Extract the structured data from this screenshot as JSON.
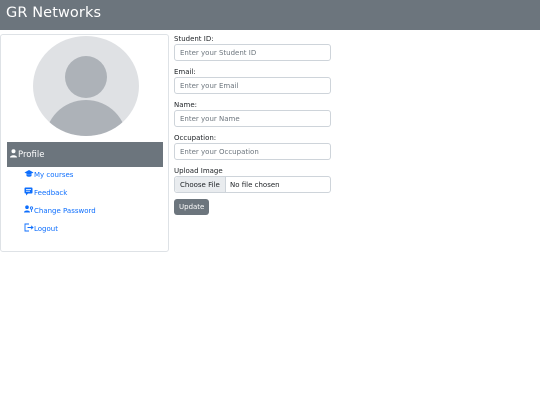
{
  "app": {
    "brand": "GR Networks"
  },
  "sidebar": {
    "profile_label": "Profile",
    "items": [
      {
        "label": "My courses",
        "icon": "graduation-cap-icon"
      },
      {
        "label": "Feedback",
        "icon": "chat-icon"
      },
      {
        "label": "Change Password",
        "icon": "user-key-icon"
      },
      {
        "label": "Logout",
        "icon": "logout-icon"
      }
    ]
  },
  "form": {
    "student_id": {
      "label": "Student ID:",
      "placeholder": "Enter your Student ID",
      "value": ""
    },
    "email": {
      "label": "Email:",
      "placeholder": "Enter your Email",
      "value": ""
    },
    "name": {
      "label": "Name:",
      "placeholder": "Enter your Name",
      "value": ""
    },
    "occupation": {
      "label": "Occupation:",
      "placeholder": "Enter your Occupation",
      "value": ""
    },
    "upload": {
      "label": "Upload Image",
      "button_label": "Choose File",
      "status": "No file chosen"
    },
    "submit_label": "Update"
  },
  "colors": {
    "navbar": "#6c757d",
    "link": "#0d6efd",
    "button": "#6c757d"
  }
}
